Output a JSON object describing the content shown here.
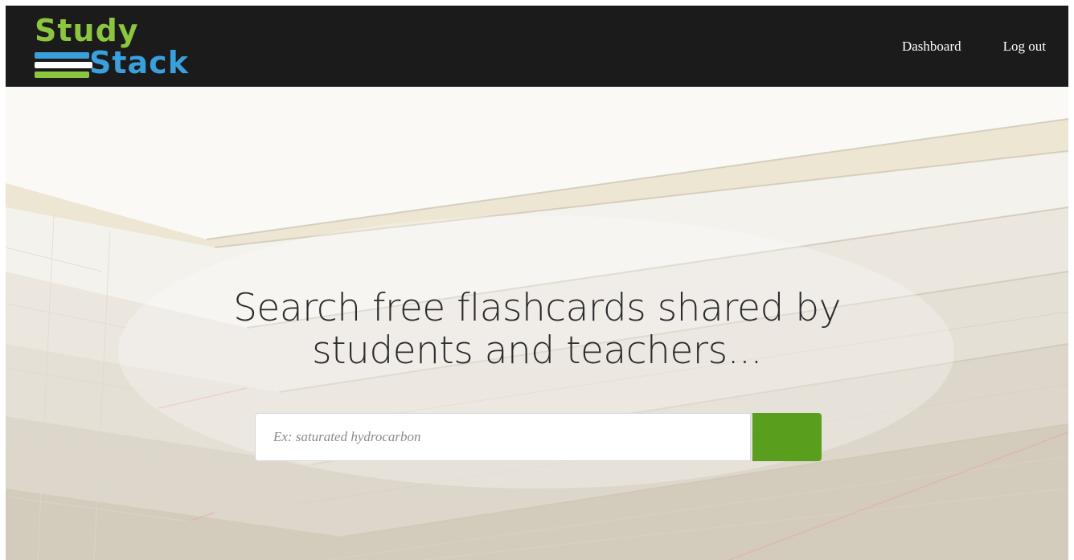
{
  "brand": {
    "line1": "Study",
    "line2": "Stack",
    "colors": {
      "green": "#8cc63f",
      "blue": "#3aa0dc"
    }
  },
  "nav": {
    "items": [
      {
        "label": "Dashboard"
      },
      {
        "label": "Log out"
      }
    ]
  },
  "hero": {
    "headline_line1": "Search free flashcards shared by",
    "headline_line2": "students and teachers..."
  },
  "search": {
    "placeholder": "Ex: saturated hydrocarbon",
    "value": "",
    "button_icon": "search-icon",
    "button_color": "#5a9e1e"
  }
}
